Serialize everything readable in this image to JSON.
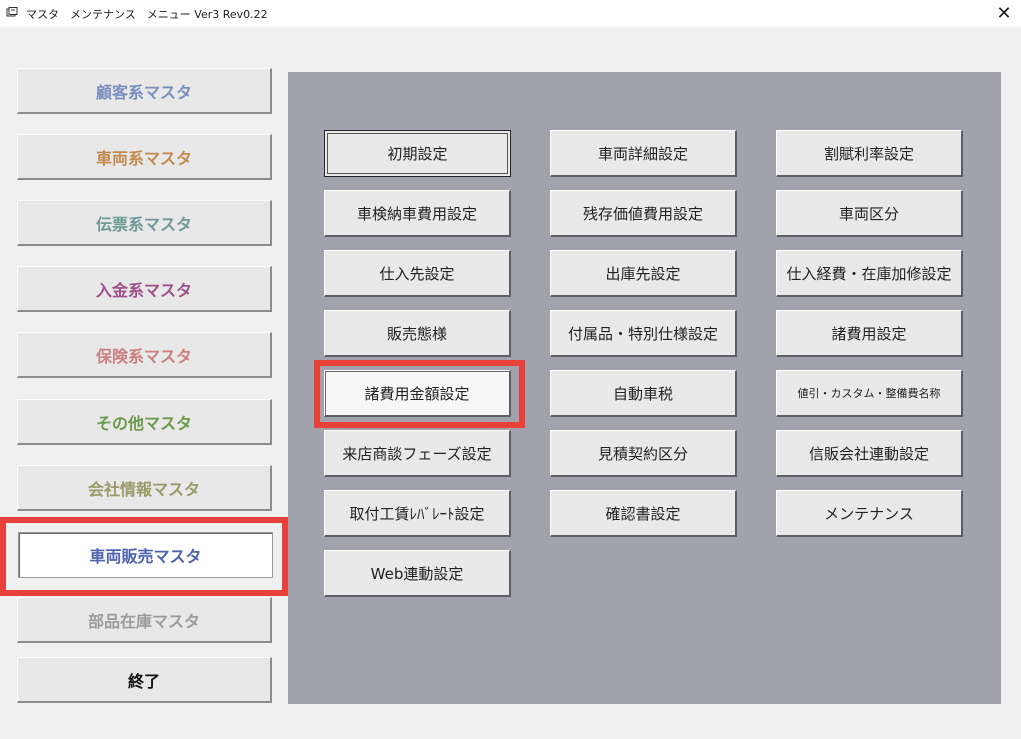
{
  "window": {
    "title": "マスタ　メンテナンス　メニュー Ver3 Rev0.22",
    "close_label": "✕"
  },
  "left_menu": [
    {
      "label": "顧客系マスタ",
      "color": "#7a8fc0"
    },
    {
      "label": "車両系マスタ",
      "color": "#c48a4f"
    },
    {
      "label": "伝票系マスタ",
      "color": "#6f9a98"
    },
    {
      "label": "入金系マスタ",
      "color": "#a0508a"
    },
    {
      "label": "保険系マスタ",
      "color": "#cc8080"
    },
    {
      "label": "その他マスタ",
      "color": "#6e9a4c"
    },
    {
      "label": "会社情報マスタ",
      "color": "#9a9a6a"
    },
    {
      "label": "車両販売マスタ",
      "color": "#4b63b0",
      "selected": true
    },
    {
      "label": "部品在庫マスタ",
      "color": "#9c9c9c"
    },
    {
      "label": "終了",
      "color": "#111111"
    }
  ],
  "grid": [
    [
      "初期設定",
      "車両詳細設定",
      "割賦利率設定"
    ],
    [
      "車検納車費用設定",
      "残存価値費用設定",
      "車両区分"
    ],
    [
      "仕入先設定",
      "出庫先設定",
      "仕入経費・在庫加修設定"
    ],
    [
      "販売態様",
      "付属品・特別仕様設定",
      "諸費用設定"
    ],
    [
      "諸費用金額設定",
      "自動車税",
      "値引・カスタム・整備費名称"
    ],
    [
      "来店商談フェーズ設定",
      "見積契約区分",
      "信販会社連動設定"
    ],
    [
      "取付工賃ﾚﾊﾞﾚｰﾄ設定",
      "確認書設定",
      "メンテナンス"
    ],
    [
      "Web連動設定"
    ]
  ],
  "colors": {
    "highlight": "#e8413b",
    "panel": "#a2a2ad"
  }
}
